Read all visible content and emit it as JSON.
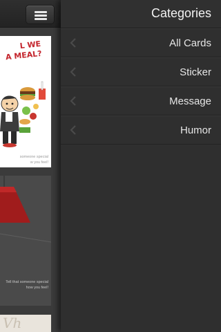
{
  "feed": {
    "menu_icon": "hamburger-menu-icon",
    "cards": [
      {
        "headline_1": "L WE",
        "headline_2": "A MEAL?",
        "caption_1": "someone special",
        "caption_2": "w you feel!"
      },
      {
        "caption_1": "Tell that someone special",
        "caption_2": "how you feel!"
      },
      {
        "script_text": "Vh"
      }
    ]
  },
  "drawer": {
    "title": "Categories",
    "items": [
      {
        "label": "All Cards",
        "icon": "chevron-left-icon"
      },
      {
        "label": "Sticker",
        "icon": "chevron-left-icon"
      },
      {
        "label": "Message",
        "icon": "chevron-left-icon"
      },
      {
        "label": "Humor",
        "icon": "chevron-left-icon"
      }
    ]
  },
  "colors": {
    "drawer_bg": "#2f2f2f",
    "text": "#e6e6e6",
    "chevron": "#4a4a4a",
    "card_accent_red": "#c4262e"
  }
}
